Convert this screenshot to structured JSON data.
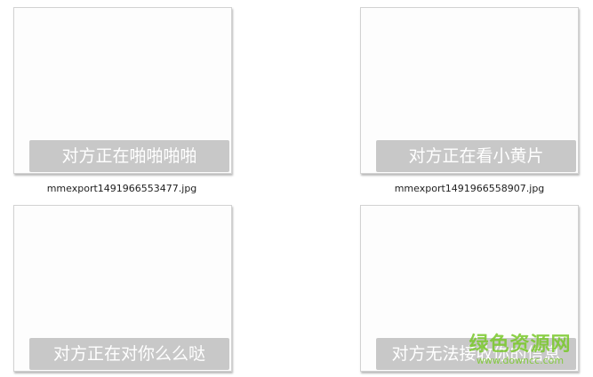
{
  "files": [
    {
      "caption": "对方正在啪啪啪啪",
      "filename": "mmexport1491966553477.jpg"
    },
    {
      "caption": "对方正在看小黄片",
      "filename": "mmexport1491966558907.jpg"
    },
    {
      "caption": "对方正在对你么么哒",
      "filename": ""
    },
    {
      "caption": "对方无法接收你的信息",
      "filename": ""
    }
  ],
  "watermark": {
    "main": "绿色资源网",
    "sub": "www.downcc.com"
  },
  "colors": {
    "caption_bg": "#c8c8c8",
    "watermark": "#78c828"
  }
}
